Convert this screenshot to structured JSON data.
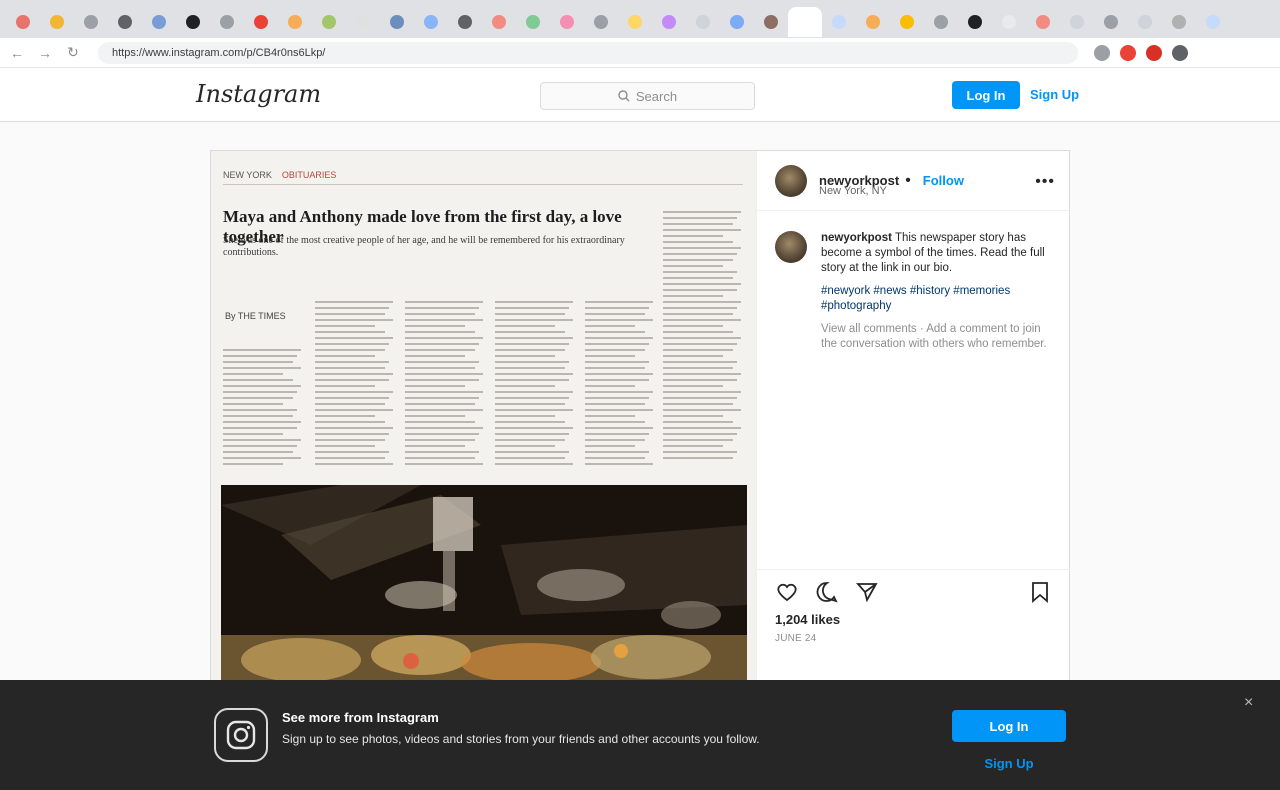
{
  "browser": {
    "tab_colors": [
      "#e8736b",
      "#f2b632",
      "#9aa0a6",
      "#5f6368",
      "#7a9cd6",
      "#202124",
      "#9aa0a6",
      "#ea4335",
      "#f6ad55",
      "#a3c66b",
      "#e0e0e0",
      "#6c8ebf",
      "#8ab4f8",
      "#5f6368",
      "#f28b82",
      "#81c995",
      "#f48fb1",
      "#9aa0a6",
      "#fdd663",
      "#c58af9",
      "#ced4da",
      "#7baaf7",
      "#8d6e63",
      "#ffffff",
      "#c6dafc",
      "#f6ad55",
      "#fbbc04",
      "#9aa0a6",
      "#202124",
      "#e8eaed",
      "#f28b82",
      "#ced4da",
      "#9aa0a6",
      "#ced4da",
      "#b0b0b0",
      "#c6dafc"
    ],
    "url": "https://www.instagram.com/p/CB4r0ns6Lkp/",
    "extension_colors": [
      "#9aa0a6",
      "#ea4335",
      "#d93025",
      "#5f6368"
    ]
  },
  "header": {
    "logo": "Instagram",
    "search_placeholder": "Search",
    "login_label": "Log In",
    "signup_label": "Sign Up"
  },
  "post": {
    "paper_section": "NEW YORK",
    "paper_section_accent": "OBITUARIES",
    "paper_title": "Maya and Anthony made love from the first day, a love together",
    "paper_subtitle": "She was one of the most creative people of her age, and he will be remembered for his extraordinary contributions.",
    "paper_byline": "By THE TIMES",
    "username": "newyorkpost",
    "location": "New York, NY",
    "follow_label": "Follow",
    "more_label": "•••",
    "caption_user": "newyorkpost",
    "caption_text": "This newspaper story has become a symbol of the times. Read the full story at the link in our bio.",
    "caption_tags": "#newyork #news #history #memories #photography",
    "caption_muted": "View all comments · Add a comment to join the conversation with others who remember.",
    "likes": "1,204 likes",
    "date": "JUNE 24"
  },
  "banner": {
    "title": "See more from Instagram",
    "text": "Sign up to see photos, videos and stories from your friends and other accounts you follow.",
    "login_label": "Log In",
    "signup_label": "Sign Up",
    "close_label": "×"
  },
  "icons": {
    "search": "search-icon",
    "heart": "heart-icon",
    "comment": "comment-icon",
    "share": "share-icon",
    "bookmark": "bookmark-icon",
    "close": "close-icon",
    "instagram": "instagram-logo-icon"
  }
}
